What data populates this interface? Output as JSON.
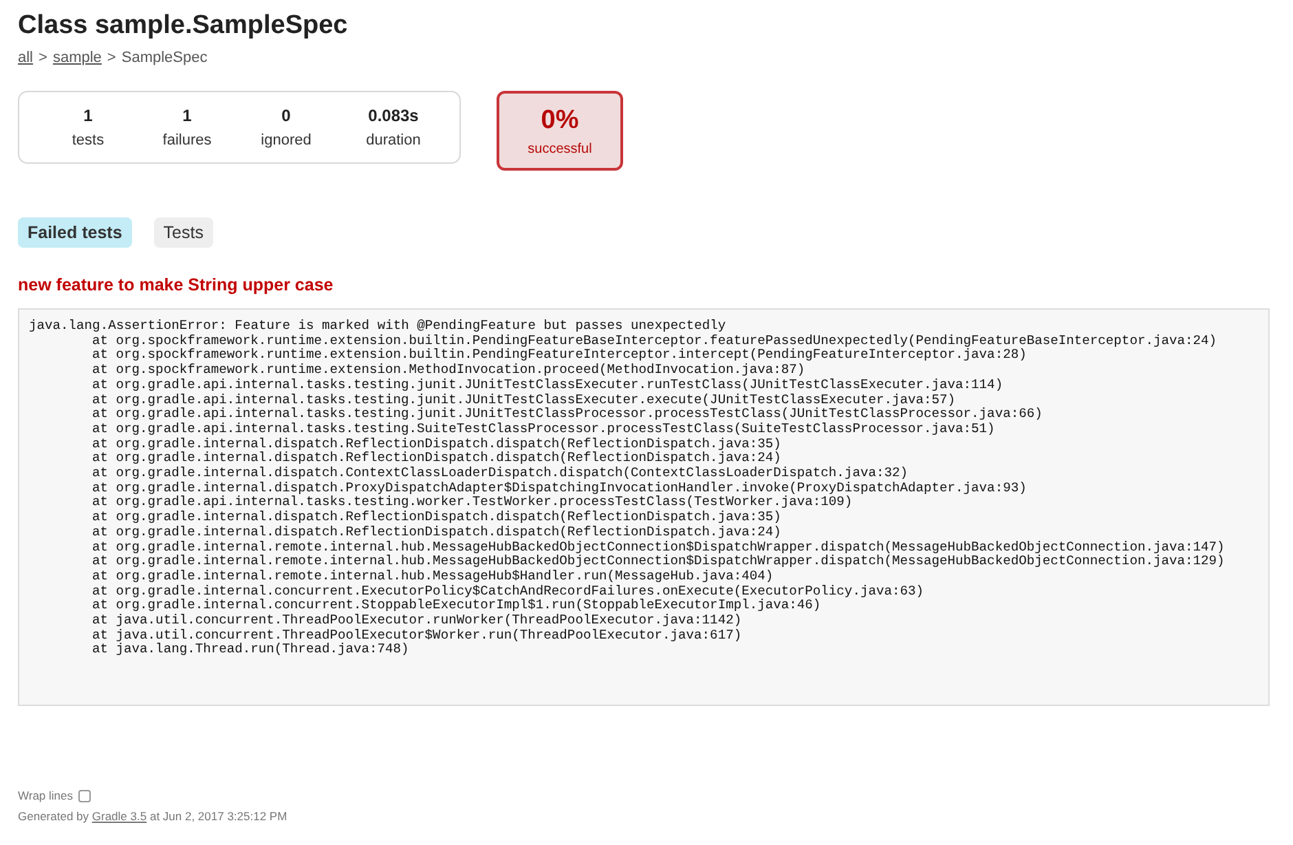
{
  "title": "Class sample.SampleSpec",
  "breadcrumb": [
    {
      "kind": "link",
      "label": "all"
    },
    {
      "kind": "separator",
      "label": ">"
    },
    {
      "kind": "link",
      "label": "sample"
    },
    {
      "kind": "separator",
      "label": ">"
    },
    {
      "kind": "current",
      "label": "SampleSpec"
    }
  ],
  "summary": [
    {
      "value": "1",
      "label": "tests"
    },
    {
      "value": "1",
      "label": "failures"
    },
    {
      "value": "0",
      "label": "ignored"
    },
    {
      "value": "0.083s",
      "label": "duration"
    }
  ],
  "success": {
    "value": "0%",
    "label": "successful"
  },
  "tabs": [
    {
      "label": "Failed tests",
      "selected": true
    },
    {
      "label": "Tests",
      "selected": false
    }
  ],
  "failed_test": {
    "name": "new feature to make String upper case",
    "exception": "java.lang.AssertionError: Feature is marked with @PendingFeature but passes unexpectedly",
    "frames": [
      "at org.spockframework.runtime.extension.builtin.PendingFeatureBaseInterceptor.featurePassedUnexpectedly(PendingFeatureBaseInterceptor.java:24)",
      "at org.spockframework.runtime.extension.builtin.PendingFeatureInterceptor.intercept(PendingFeatureInterceptor.java:28)",
      "at org.spockframework.runtime.extension.MethodInvocation.proceed(MethodInvocation.java:87)",
      "at org.gradle.api.internal.tasks.testing.junit.JUnitTestClassExecuter.runTestClass(JUnitTestClassExecuter.java:114)",
      "at org.gradle.api.internal.tasks.testing.junit.JUnitTestClassExecuter.execute(JUnitTestClassExecuter.java:57)",
      "at org.gradle.api.internal.tasks.testing.junit.JUnitTestClassProcessor.processTestClass(JUnitTestClassProcessor.java:66)",
      "at org.gradle.api.internal.tasks.testing.SuiteTestClassProcessor.processTestClass(SuiteTestClassProcessor.java:51)",
      "at org.gradle.internal.dispatch.ReflectionDispatch.dispatch(ReflectionDispatch.java:35)",
      "at org.gradle.internal.dispatch.ReflectionDispatch.dispatch(ReflectionDispatch.java:24)",
      "at org.gradle.internal.dispatch.ContextClassLoaderDispatch.dispatch(ContextClassLoaderDispatch.java:32)",
      "at org.gradle.internal.dispatch.ProxyDispatchAdapter$DispatchingInvocationHandler.invoke(ProxyDispatchAdapter.java:93)",
      "at org.gradle.api.internal.tasks.testing.worker.TestWorker.processTestClass(TestWorker.java:109)",
      "at org.gradle.internal.dispatch.ReflectionDispatch.dispatch(ReflectionDispatch.java:35)",
      "at org.gradle.internal.dispatch.ReflectionDispatch.dispatch(ReflectionDispatch.java:24)",
      "at org.gradle.internal.remote.internal.hub.MessageHubBackedObjectConnection$DispatchWrapper.dispatch(MessageHubBackedObjectConnection.java:147)",
      "at org.gradle.internal.remote.internal.hub.MessageHubBackedObjectConnection$DispatchWrapper.dispatch(MessageHubBackedObjectConnection.java:129)",
      "at org.gradle.internal.remote.internal.hub.MessageHub$Handler.run(MessageHub.java:404)",
      "at org.gradle.internal.concurrent.ExecutorPolicy$CatchAndRecordFailures.onExecute(ExecutorPolicy.java:63)",
      "at org.gradle.internal.concurrent.StoppableExecutorImpl$1.run(StoppableExecutorImpl.java:46)",
      "at java.util.concurrent.ThreadPoolExecutor.runWorker(ThreadPoolExecutor.java:1142)",
      "at java.util.concurrent.ThreadPoolExecutor$Worker.run(ThreadPoolExecutor.java:617)",
      "at java.lang.Thread.run(Thread.java:748)"
    ]
  },
  "footer": {
    "wrap_lines": {
      "label": "Wrap lines",
      "checked": false
    },
    "generated_prefix": "Generated by",
    "generator_link": "Gradle 3.5",
    "generated_suffix": "at Jun 2, 2017 3:25:12 PM"
  }
}
